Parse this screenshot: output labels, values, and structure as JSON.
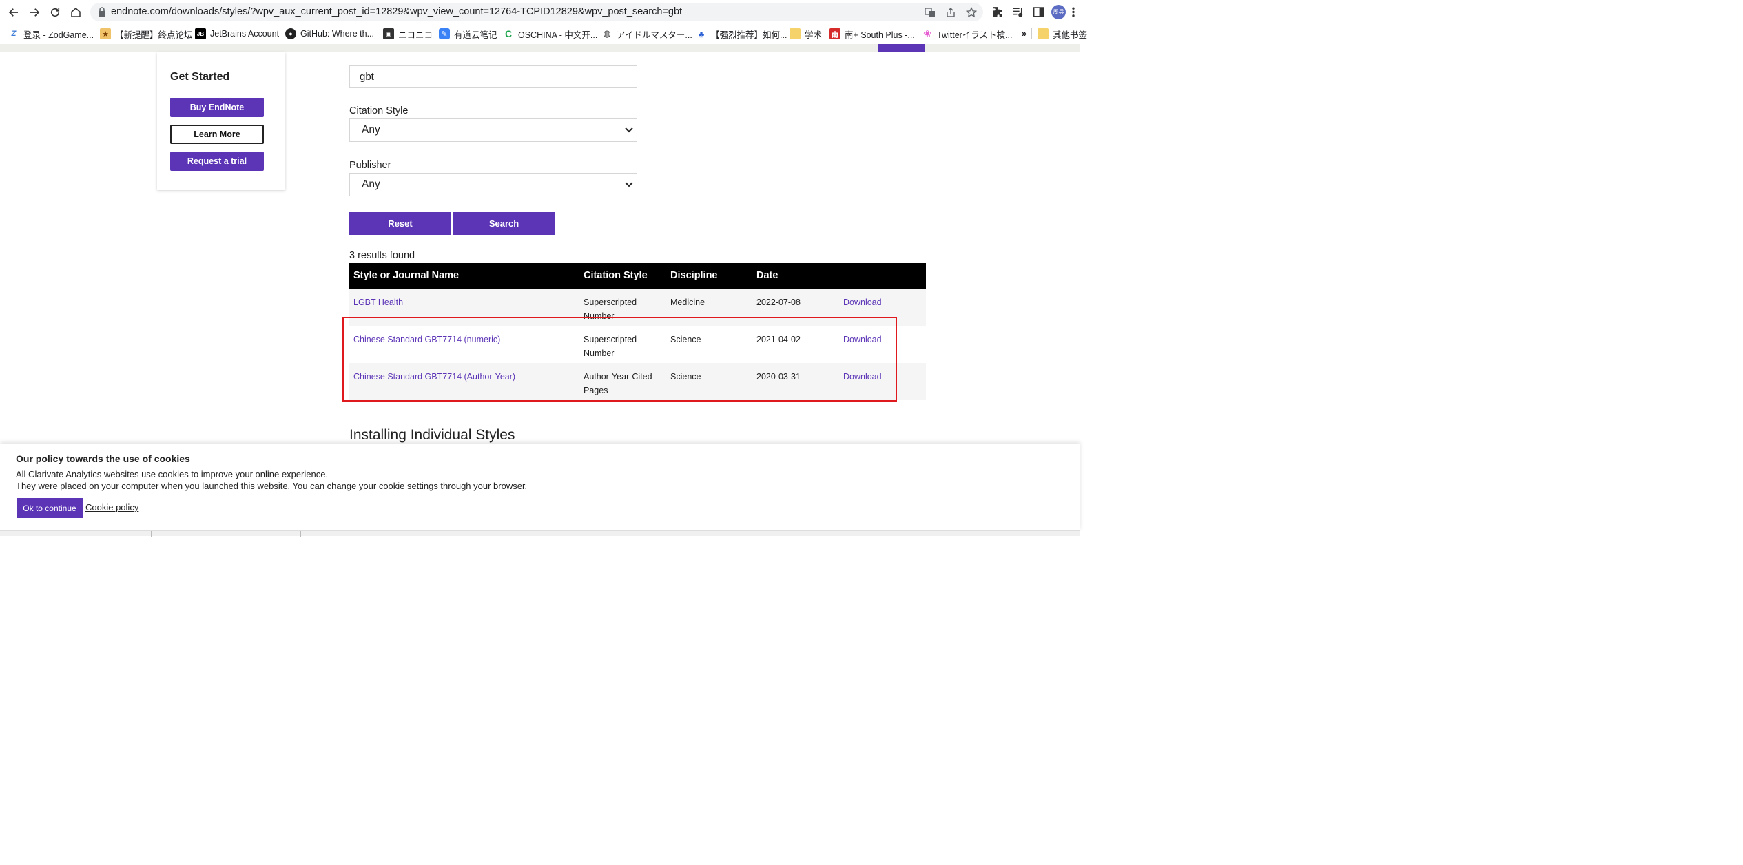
{
  "browser": {
    "url": "endnote.com/downloads/styles/?wpv_aux_current_post_id=12829&wpv_view_count=12764-TCPID12829&wpv_post_search=gbt",
    "profile_label": "周兵",
    "bookmarks": [
      {
        "label": "登录 - ZodGame...",
        "icon": "zodgame-icon"
      },
      {
        "label": "【新提醒】终点论坛",
        "icon": "forum-icon"
      },
      {
        "label": "JetBrains Account",
        "icon": "jetbrains-icon"
      },
      {
        "label": "GitHub: Where th...",
        "icon": "github-icon"
      },
      {
        "label": "ニコニコ",
        "icon": "niconico-icon"
      },
      {
        "label": "有道云笔记",
        "icon": "youdao-icon"
      },
      {
        "label": "OSCHINA - 中文开...",
        "icon": "oschina-icon"
      },
      {
        "label": "アイドルマスター...",
        "icon": "globe-icon"
      },
      {
        "label": "【强烈推荐】如何...",
        "icon": "baidu-icon"
      },
      {
        "label": "学术",
        "icon": "folder-icon"
      },
      {
        "label": "南+ South Plus -...",
        "icon": "southplus-icon"
      },
      {
        "label": "Twitterイラスト検...",
        "icon": "twitter-search-icon"
      }
    ],
    "bookmarks_overflow": "»",
    "other_bookmarks": "其他书签"
  },
  "sidebar": {
    "title": "Get Started",
    "buy_label": "Buy EndNote",
    "learn_label": "Learn More",
    "trial_label": "Request a trial"
  },
  "form": {
    "search_value": "gbt",
    "citation_style_label": "Citation Style",
    "citation_style_value": "Any",
    "publisher_label": "Publisher",
    "publisher_value": "Any",
    "reset_label": "Reset",
    "search_label": "Search"
  },
  "results": {
    "count_text": "3 results found",
    "columns": [
      "Style or Journal Name",
      "Citation Style",
      "Discipline",
      "Date"
    ],
    "rows": [
      {
        "name": "LGBT Health",
        "style": "Superscripted Number",
        "discipline": "Medicine",
        "date": "2022-07-08",
        "action": "Download"
      },
      {
        "name": "Chinese Standard GBT7714 (numeric)",
        "style": "Superscripted Number",
        "discipline": "Science",
        "date": "2021-04-02",
        "action": "Download"
      },
      {
        "name": "Chinese Standard GBT7714 (Author-Year)",
        "style": "Author-Year-Cited Pages",
        "discipline": "Science",
        "date": "2020-03-31",
        "action": "Download"
      }
    ]
  },
  "section_heading": "Installing Individual Styles",
  "cookie": {
    "title": "Our policy towards the use of cookies",
    "line1": "All Clarivate Analytics websites use cookies to improve your online experience.",
    "line2": "They were placed on your computer when you launched this website. You can change your cookie settings through your browser.",
    "ok_label": "Ok to continue",
    "policy_link": "Cookie policy"
  },
  "colors": {
    "accent": "#5c35b7",
    "highlight": "#e0191f"
  }
}
